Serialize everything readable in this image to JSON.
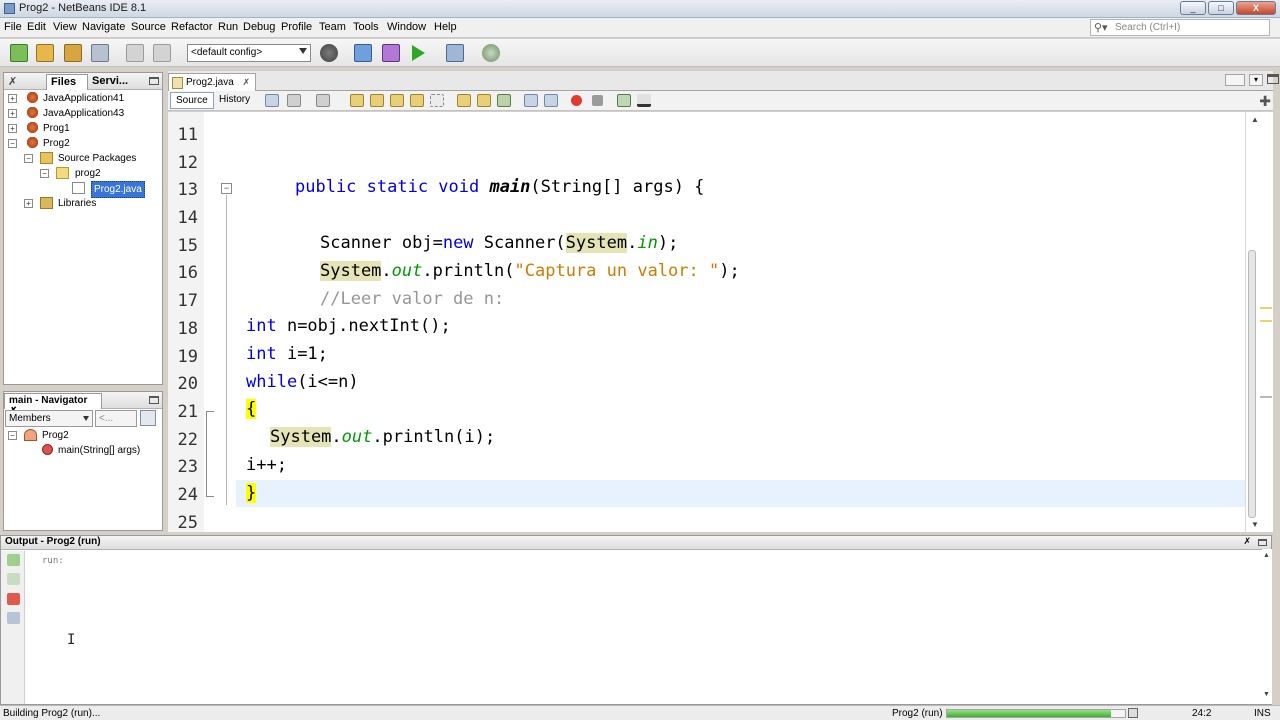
{
  "window": {
    "title": "Prog2 - NetBeans IDE 8.1",
    "controls": [
      "_",
      "□",
      "X"
    ]
  },
  "menu": {
    "items": [
      "File",
      "Edit",
      "View",
      "Navigate",
      "Source",
      "Refactor",
      "Run",
      "Debug",
      "Profile",
      "Team",
      "Tools",
      "Window",
      "Help"
    ]
  },
  "search": {
    "placeholder": "Search (Ctrl+I)"
  },
  "toolbar": {
    "config": "<default config>"
  },
  "projects_panel": {
    "tabs": [
      "Files",
      "Servi..."
    ],
    "tree": [
      {
        "label": "JavaApplication41",
        "type": "project"
      },
      {
        "label": "JavaApplication43",
        "type": "project"
      },
      {
        "label": "Prog1",
        "type": "project"
      },
      {
        "label": "Prog2",
        "type": "project",
        "expanded": true
      },
      {
        "label": "Source Packages",
        "type": "folder"
      },
      {
        "label": "prog2",
        "type": "package"
      },
      {
        "label": "Prog2.java",
        "type": "file",
        "selected": true
      },
      {
        "label": "Libraries",
        "type": "library"
      }
    ]
  },
  "navigator": {
    "title": "main - Navigator",
    "filter": "Members",
    "filter2": "<...",
    "tree": [
      {
        "label": "Prog2",
        "type": "class"
      },
      {
        "label": "main(String[] args)",
        "type": "method"
      }
    ]
  },
  "editor": {
    "tab": "Prog2.java",
    "mode_buttons": [
      "Source",
      "History"
    ],
    "line_numbers": [
      "11",
      "12",
      "13",
      "14",
      "15",
      "16",
      "17",
      "18",
      "19",
      "20",
      "21",
      "22",
      "23",
      "24",
      "25"
    ],
    "code": {
      "l13_kw": "public static void ",
      "l13_name": "main",
      "l13_rest": "(String[] args) {",
      "l15_a": "Scanner obj=",
      "l15_kw": "new",
      "l15_b": " Scanner(",
      "l15_sys": "System",
      "l15_dot": ".",
      "l15_in": "in",
      "l15_c": ");",
      "l16_sys": "System",
      "l16_dot": ".",
      "l16_out": "out",
      "l16_a": ".println(",
      "l16_str": "\"Captura un valor: \"",
      "l16_b": ");",
      "l17_cmt": "//Leer valor de n:",
      "l18_kw": "int",
      "l18_rest": " n=obj.nextInt();",
      "l19_kw": "int",
      "l19_rest": " i=1;",
      "l20_kw": "while",
      "l20_rest": "(i<=n)",
      "l21": "{",
      "l22_sys": "System",
      "l22_dot": ".",
      "l22_out": "out",
      "l22_rest": ".println(i);",
      "l23": "i++;",
      "l24": "}"
    }
  },
  "output": {
    "title": "Output - Prog2 (run)",
    "text": "run:"
  },
  "statusbar": {
    "left": "Building Prog2 (run)...",
    "task": "Prog2 (run)",
    "progress": 0.92,
    "position": "24:2",
    "mode": "INS"
  }
}
